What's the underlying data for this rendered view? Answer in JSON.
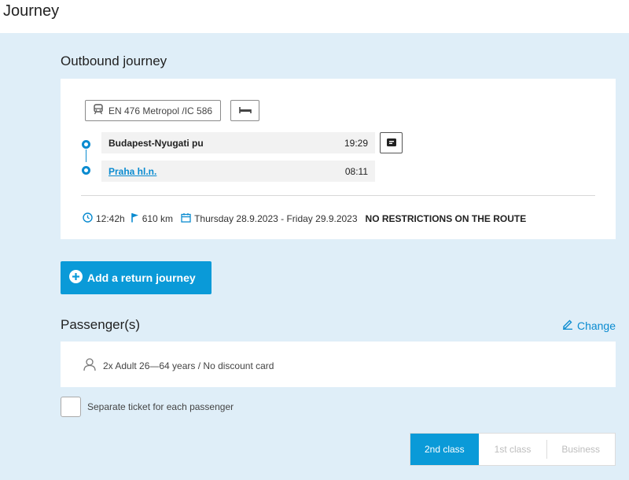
{
  "page_title": "Journey",
  "colors": {
    "accent": "#0a9ad8",
    "background": "#dfeef8",
    "card": "#ffffff"
  },
  "outbound": {
    "title": "Outbound journey",
    "train_label": "EN 476 Metropol /IC 586",
    "train_icon": "train-icon",
    "bed_icon": "bed-icon",
    "stops": [
      {
        "name": "Budapest-Nyugati pu",
        "time": "19:29",
        "is_link": false
      },
      {
        "name": "Praha hl.n.",
        "time": "08:11",
        "is_link": true
      }
    ],
    "info_icon": "info-card-icon",
    "duration": "12:42h",
    "distance": "610 km",
    "dates": "Thursday 28.9.2023 - Friday 29.9.2023",
    "restrictions": "NO RESTRICTIONS ON THE ROUTE"
  },
  "return_button": {
    "label": "Add a return journey",
    "icon": "plus-circle-icon"
  },
  "passengers": {
    "title": "Passenger(s)",
    "change_label": "Change",
    "summary": "2x Adult 26—64 years / No discount card",
    "separate_ticket_label": "Separate ticket for each passenger",
    "separate_ticket_checked": false
  },
  "class_options": [
    {
      "label": "2nd class",
      "active": true
    },
    {
      "label": "1st class",
      "active": false
    },
    {
      "label": "Business",
      "active": false
    }
  ]
}
